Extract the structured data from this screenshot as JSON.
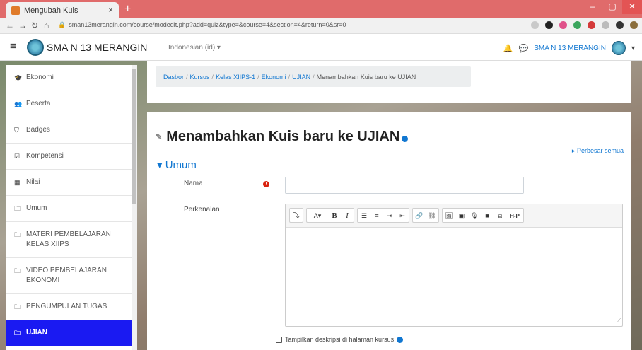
{
  "browser": {
    "tab_title": "Mengubah Kuis",
    "tab_close": "×",
    "new_tab": "+",
    "url": "sman13merangin.com/course/modedit.php?add=quiz&type=&course=4&section=4&return=0&sr=0",
    "window_controls": {
      "minimize": "–",
      "maximize": "▢",
      "close": "✕"
    }
  },
  "topbar": {
    "site_name": "SMA N 13 MERANGIN",
    "language": "Indonesian (id) ▾",
    "user_name": "SMA N 13 MERANGIN"
  },
  "sidebar": {
    "items": [
      {
        "label": "Ekonomi",
        "icon": "graduation-cap-icon"
      },
      {
        "label": "Peserta",
        "icon": "users-icon"
      },
      {
        "label": "Badges",
        "icon": "shield-icon"
      },
      {
        "label": "Kompetensi",
        "icon": "check-square-icon"
      },
      {
        "label": "Nilai",
        "icon": "table-icon"
      },
      {
        "label": "Umum",
        "icon": "folder-icon"
      },
      {
        "label": "MATERI PEMBELAJARAN KELAS XIIPS",
        "icon": "folder-icon"
      },
      {
        "label": "VIDEO PEMBELAJARAN EKONOMI",
        "icon": "folder-icon"
      },
      {
        "label": "PENGUMPULAN TUGAS",
        "icon": "folder-icon"
      },
      {
        "label": "UJIAN",
        "icon": "folder-icon",
        "active": true
      }
    ]
  },
  "breadcrumb": {
    "items": [
      "Dasbor",
      "Kursus",
      "Kelas XIIPS-1",
      "Ekonomi",
      "UJIAN",
      "Menambahkan Kuis baru ke UJIAN"
    ],
    "separator": "/"
  },
  "page": {
    "title": "Menambahkan Kuis baru ke UJIAN",
    "expand_all": "Perbesar semua",
    "section": "Umum",
    "name_label": "Nama",
    "intro_label": "Perkenalan",
    "name_value": "",
    "show_description_label": "Tampilkan deskripsi di halaman kursus"
  },
  "editor_toolbar": {
    "groups": [
      [
        "⤵"
      ],
      [
        "A▾",
        "B",
        "I"
      ],
      [
        "☰",
        "≡",
        "⇥",
        "⇤"
      ],
      [
        "🔗",
        "⛓"
      ],
      [
        "🖼",
        "▣",
        "🎙",
        "■",
        "⧉",
        "H-P"
      ]
    ]
  },
  "colors": {
    "accent": "#1177d1",
    "active_nav": "#1a1af2",
    "required": "#d9230f",
    "browser_tabbar": "#e06b6b"
  }
}
